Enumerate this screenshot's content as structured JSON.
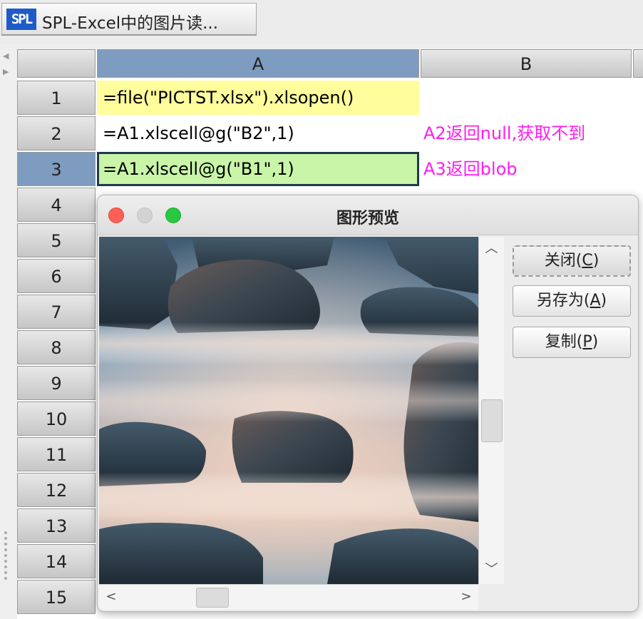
{
  "tab": {
    "logo": "SPL",
    "title": "SPL-Excel中的图片读..."
  },
  "grid": {
    "columns": [
      "A",
      "B"
    ],
    "rows": [
      "1",
      "2",
      "3",
      "4",
      "5",
      "6",
      "7",
      "8",
      "9",
      "10",
      "11",
      "12",
      "13",
      "14",
      "15"
    ],
    "selected_row": "3",
    "selected_column": "A",
    "cells": {
      "A1": "=file(\"PICTST.xlsx\").xlsopen()",
      "A2": "=A1.xlscell@g(\"B2\",1)",
      "A3": "=A1.xlscell@g(\"B1\",1)",
      "B2": "A2返回null,获取不到",
      "B3": "A3返回blob"
    },
    "colors": {
      "a1_bg": "#fffd9c",
      "a3_bg": "#c8f5a8",
      "note": "#ff1cf0",
      "selection": "#7e9cbf"
    }
  },
  "dialog": {
    "title": "图形预览",
    "buttons": {
      "close": {
        "prefix": "关闭(",
        "key": "C",
        "suffix": ")"
      },
      "save_as": {
        "prefix": "另存为(",
        "key": "A",
        "suffix": ")"
      },
      "copy": {
        "prefix": "复制(",
        "key": "P",
        "suffix": ")"
      }
    },
    "image": "misty-rocks-seascape"
  }
}
